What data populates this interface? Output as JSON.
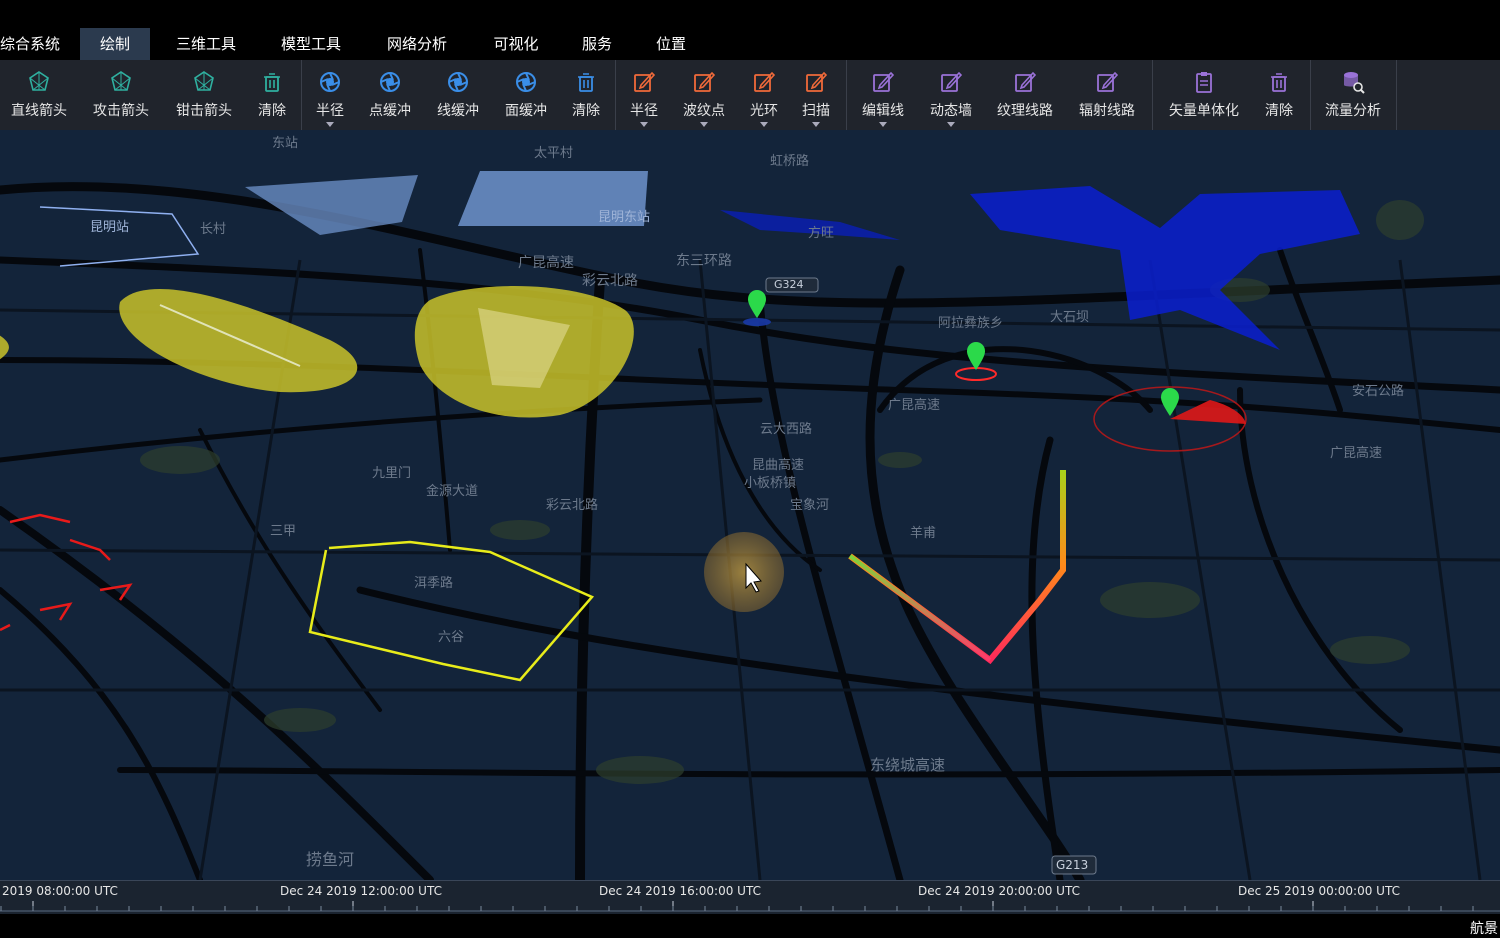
{
  "menu": {
    "items": [
      {
        "label": "综合系统"
      },
      {
        "label": "绘制"
      },
      {
        "label": "三维工具"
      },
      {
        "label": "模型工具"
      },
      {
        "label": "网络分析"
      },
      {
        "label": "可视化"
      },
      {
        "label": "服务"
      },
      {
        "label": "位置"
      }
    ],
    "active_index": 1
  },
  "toolbar": {
    "tools": [
      {
        "label": "直线箭头",
        "icon": "arrow-draw-icon",
        "color": "#2fb0a0"
      },
      {
        "label": "攻击箭头",
        "icon": "arrow-draw-icon",
        "color": "#2fb0a0"
      },
      {
        "label": "钳击箭头",
        "icon": "arrow-draw-icon",
        "color": "#2fb0a0"
      },
      {
        "label": "清除",
        "icon": "trash-icon",
        "color": "#2fb0a0"
      },
      {
        "label": "半径",
        "icon": "aperture-icon",
        "color": "#3a8ee8"
      },
      {
        "label": "点缓冲",
        "icon": "aperture-icon",
        "color": "#3a8ee8"
      },
      {
        "label": "线缓冲",
        "icon": "aperture-icon",
        "color": "#3a8ee8"
      },
      {
        "label": "面缓冲",
        "icon": "aperture-icon",
        "color": "#3a8ee8"
      },
      {
        "label": "清除",
        "icon": "trash-icon",
        "color": "#3a8ee8"
      },
      {
        "label": "半径",
        "icon": "edit-icon",
        "color": "#f06a3a"
      },
      {
        "label": "波纹点",
        "icon": "edit-icon",
        "color": "#f06a3a"
      },
      {
        "label": "光环",
        "icon": "edit-icon",
        "color": "#f06a3a"
      },
      {
        "label": "扫描",
        "icon": "edit-icon",
        "color": "#f06a3a"
      },
      {
        "label": "编辑线",
        "icon": "edit-icon",
        "color": "#9a72d8"
      },
      {
        "label": "动态墙",
        "icon": "edit-icon",
        "color": "#9a72d8"
      },
      {
        "label": "纹理线路",
        "icon": "edit-icon",
        "color": "#9a72d8"
      },
      {
        "label": "辐射线路",
        "icon": "edit-icon",
        "color": "#9a72d8"
      },
      {
        "label": "矢量单体化",
        "icon": "clipboard-icon",
        "color": "#9a72d8"
      },
      {
        "label": "清除",
        "icon": "trash-icon",
        "color": "#9a72d8"
      },
      {
        "label": "流量分析",
        "icon": "database-search-icon",
        "color": "#9a72d8"
      }
    ]
  },
  "map": {
    "labels": [
      {
        "text": "东站"
      },
      {
        "text": "太平村"
      },
      {
        "text": "虹桥路"
      },
      {
        "text": "昆明站"
      },
      {
        "text": "长村"
      },
      {
        "text": "昆明东站"
      },
      {
        "text": "方旺"
      },
      {
        "text": "广昆高速"
      },
      {
        "text": "东三环路"
      },
      {
        "text": "彩云北路"
      },
      {
        "text": "G324"
      },
      {
        "text": "阿拉彝族乡"
      },
      {
        "text": "大石坝"
      },
      {
        "text": "广昆高速"
      },
      {
        "text": "云大西路"
      },
      {
        "text": "昆曲高速"
      },
      {
        "text": "小板桥镇"
      },
      {
        "text": "宝象河"
      },
      {
        "text": "九里门"
      },
      {
        "text": "金源大道"
      },
      {
        "text": "彩云北路"
      },
      {
        "text": "三甲"
      },
      {
        "text": "洱季路"
      },
      {
        "text": "六谷"
      },
      {
        "text": "羊甫"
      },
      {
        "text": "东绕城高速"
      },
      {
        "text": "捞鱼河"
      },
      {
        "text": "G213"
      },
      {
        "text": "广昆高速"
      },
      {
        "text": "安石公路"
      }
    ]
  },
  "timeline": {
    "labels": [
      "2019 08:00:00 UTC",
      "Dec 24 2019 12:00:00 UTC",
      "Dec 24 2019 16:00:00 UTC",
      "Dec 24 2019 20:00:00 UTC",
      "Dec 25 2019 00:00:00 UTC"
    ]
  },
  "footer": {
    "brand": "航景"
  }
}
